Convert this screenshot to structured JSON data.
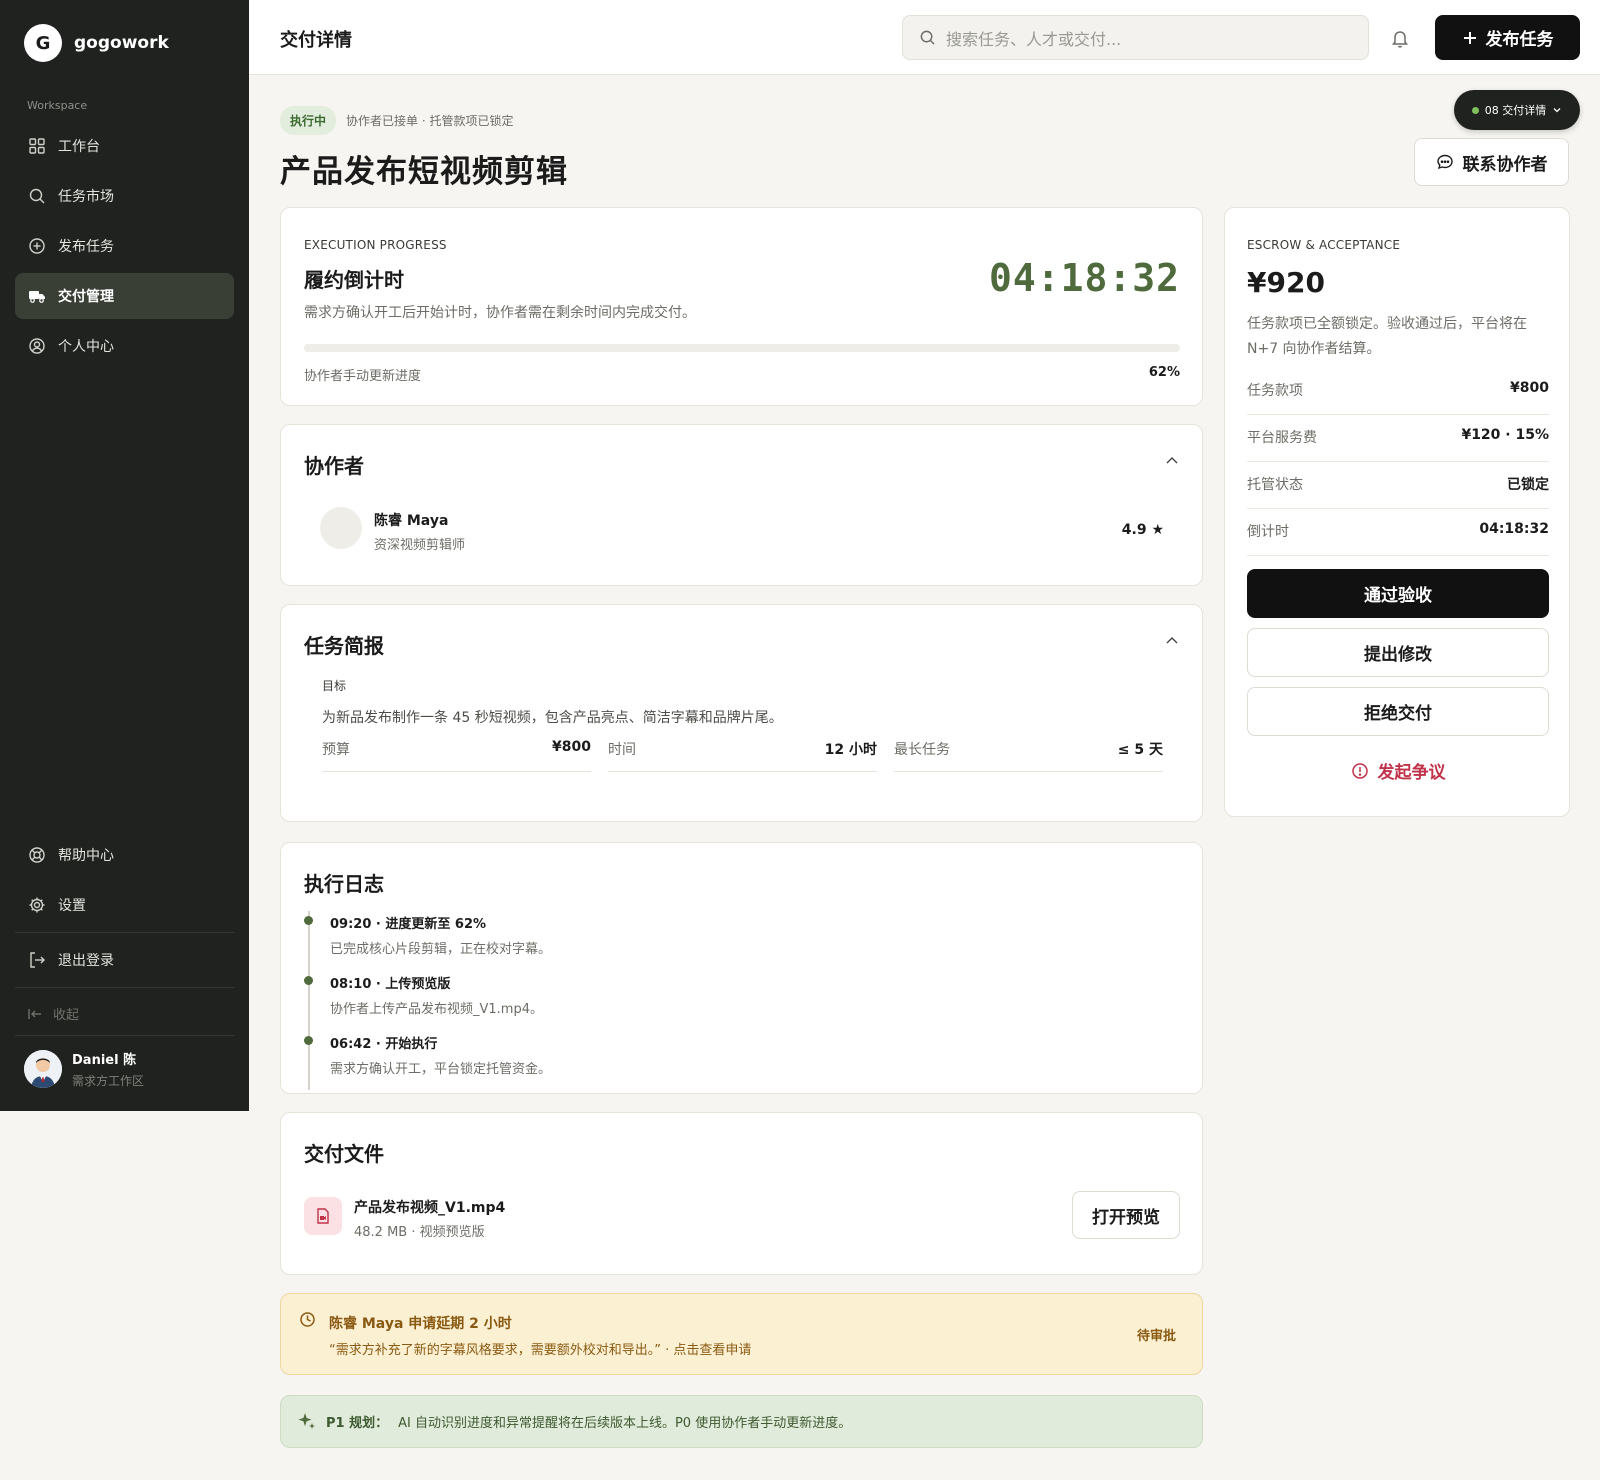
{
  "brand": {
    "logo_letter": "G",
    "name": "gogowork"
  },
  "sidebar": {
    "workspace_label": "Workspace",
    "items": [
      {
        "label": "工作台",
        "icon": "grid-icon"
      },
      {
        "label": "任务市场",
        "icon": "search-icon"
      },
      {
        "label": "发布任务",
        "icon": "plus-circle-icon"
      },
      {
        "label": "交付管理",
        "icon": "truck-icon",
        "active": true
      },
      {
        "label": "个人中心",
        "icon": "user-circle-icon"
      }
    ],
    "bottom_items": [
      {
        "label": "帮助中心",
        "icon": "lifebuoy-icon"
      },
      {
        "label": "设置",
        "icon": "gear-icon"
      },
      {
        "label": "退出登录",
        "icon": "logout-icon"
      }
    ],
    "collapse_label": "收起",
    "user": {
      "name": "Daniel 陈",
      "sub": "需求方工作区"
    }
  },
  "topbar": {
    "title": "交付详情",
    "search_placeholder": "搜索任务、人才或交付...",
    "publish_label": "发布任务"
  },
  "header": {
    "status": "执行中",
    "status_sub": "协作者已接单 · 托管款项已锁定",
    "title": "产品发布短视频剪辑",
    "jump_label": "08 交付详情",
    "contact_label": "联系协作者"
  },
  "progress": {
    "eyebrow": "EXECUTION PROGRESS",
    "title": "履约倒计时",
    "desc": "需求方确认开工后开始计时，协作者需在剩余时间内完成交付。",
    "timer": "04:18:32",
    "progress_label": "协作者手动更新进度",
    "progress_value": 0.62,
    "progress_text": "62%"
  },
  "collaborator": {
    "title": "协作者",
    "name": "陈睿 Maya",
    "role": "资深视频剪辑师",
    "rating": "4.9 ★"
  },
  "brief": {
    "title": "任务简报",
    "goal_label": "目标",
    "goal": "为新品发布制作一条 45 秒短视频，包含产品亮点、简洁字幕和品牌片尾。",
    "metrics": [
      {
        "k": "预算",
        "v": "¥800"
      },
      {
        "k": "时间",
        "v": "12 小时"
      },
      {
        "k": "最长任务",
        "v": "≤ 5 天"
      }
    ]
  },
  "log": {
    "title": "执行日志",
    "entries": [
      {
        "title": "09:20 · 进度更新至 62%",
        "desc": "已完成核心片段剪辑，正在校对字幕。"
      },
      {
        "title": "08:10 · 上传预览版",
        "desc": "协作者上传产品发布视频_V1.mp4。"
      },
      {
        "title": "06:42 · 开始执行",
        "desc": "需求方确认开工，平台锁定托管资金。"
      }
    ]
  },
  "files": {
    "title": "交付文件",
    "name": "产品发布视频_V1.mp4",
    "meta": "48.2 MB · 视频预览版",
    "preview_label": "打开预览"
  },
  "notice": {
    "title": "陈睿 Maya 申请延期 2 小时",
    "desc": "“需求方补充了新的字幕风格要求，需要额外校对和导出。” · 点击查看申请",
    "status": "待审批"
  },
  "plan": {
    "label": "P1 规划：",
    "text": "AI 自动识别进度和异常提醒将在后续版本上线。P0 使用协作者手动更新进度。"
  },
  "escrow": {
    "eyebrow": "ESCROW & ACCEPTANCE",
    "amount": "¥920",
    "desc": "任务款项已全额锁定。验收通过后，平台将在 N+7 向协作者结算。",
    "rows": [
      {
        "k": "任务款项",
        "v": "¥800"
      },
      {
        "k": "平台服务费",
        "v": "¥120 · 15%"
      },
      {
        "k": "托管状态",
        "v": "已锁定"
      },
      {
        "k": "倒计时",
        "v": "04:18:32"
      }
    ],
    "accept_label": "通过验收",
    "revise_label": "提出修改",
    "reject_label": "拒绝交付",
    "dispute_label": "发起争议"
  },
  "colors": {
    "sidebar": "#1f221e",
    "accent_green": "#4f6a3c",
    "danger": "#c0334a",
    "notice_bg": "#fcf0d3",
    "plan_bg": "#e1ebdb"
  }
}
